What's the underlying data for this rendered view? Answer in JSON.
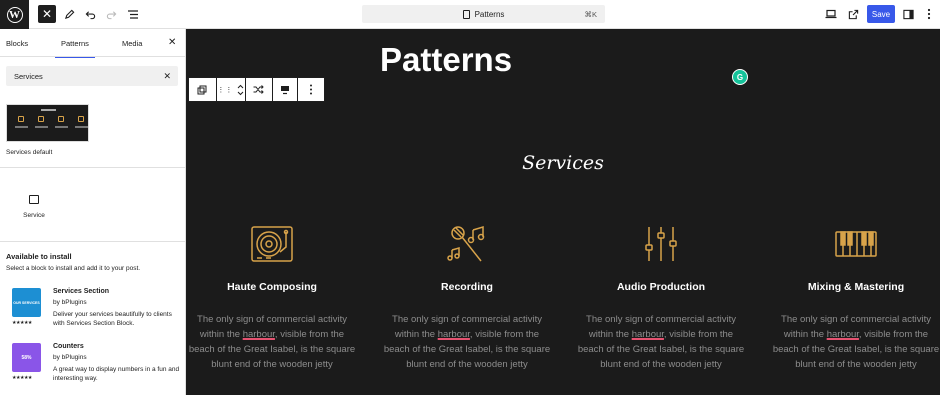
{
  "topbar": {
    "command_label": "Patterns",
    "command_shortcut": "⌘K",
    "save_label": "Save"
  },
  "sidebar": {
    "tabs": [
      {
        "label": "Blocks"
      },
      {
        "label": "Patterns"
      },
      {
        "label": "Media"
      }
    ],
    "search_value": "Services",
    "pattern_label": "Services default",
    "block_label": "Service",
    "available_title": "Available to install",
    "available_subtitle": "Select a block to install and add it to your post.",
    "plugins": [
      {
        "name": "Services Section",
        "by": "by bPlugins",
        "desc": "Deliver your services beautifully to clients with Services Section Block.",
        "icon_text": "OUR SERVICES",
        "stars": "★★★★★"
      },
      {
        "name": "Counters",
        "by": "by bPlugins",
        "desc": "A great way to display numbers in a fun and interesting way.",
        "icon_text": "58%",
        "stars": "★★★★★"
      }
    ]
  },
  "canvas": {
    "heading": "Patterns",
    "section_title": "Services",
    "services": [
      {
        "title": "Haute Composing",
        "icon": "turntable-icon",
        "desc_pre": "The only sign of commercial activity within the ",
        "desc_hl": "harbour",
        "desc_post": ", visible from the beach of the Great Isabel, is the square blunt end of the wooden jetty"
      },
      {
        "title": "Recording",
        "icon": "microphone-icon",
        "desc_pre": "The only sign of commercial activity within the ",
        "desc_hl": "harbour",
        "desc_post": ", visible from the beach of the Great Isabel, is the square blunt end of the wooden jetty"
      },
      {
        "title": "Audio Production",
        "icon": "sliders-icon",
        "desc_pre": "The only sign of commercial activity within the ",
        "desc_hl": "harbour",
        "desc_post": ", visible from the beach of the Great Isabel, is the square blunt end of the wooden jetty"
      },
      {
        "title": "Mixing & Mastering",
        "icon": "piano-keys-icon",
        "desc_pre": "The only sign of commercial activity within the ",
        "desc_hl": "harbour",
        "desc_post": ", visible from the beach of the Great Isabel, is the square blunt end of the wooden jetty"
      }
    ]
  },
  "colors": {
    "accent": "#3858e9",
    "canvas_bg": "#1b1b1b",
    "icon_gold": "#d8a34a",
    "grammarly": "#15c39a"
  }
}
